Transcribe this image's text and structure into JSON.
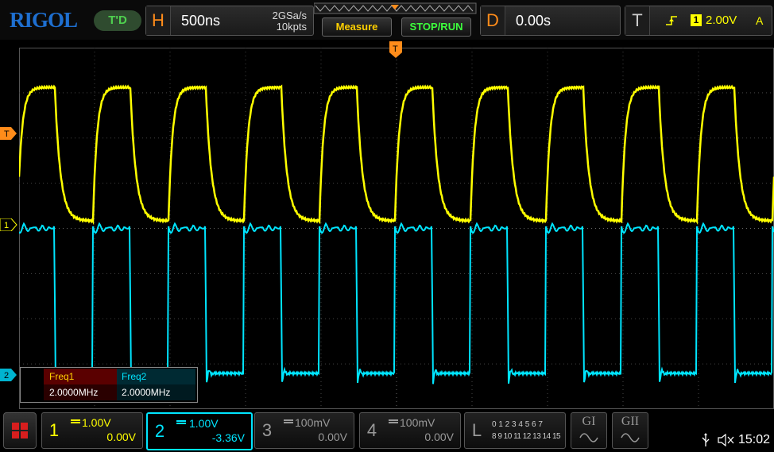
{
  "brand": "RIGOL",
  "run_mode": "T'D",
  "horizontal": {
    "letter": "H",
    "timebase": "500ns",
    "sample_rate": "2GSa/s",
    "memory": "10kpts"
  },
  "buttons": {
    "measure": "Measure",
    "stop_run": "STOP/RUN"
  },
  "delay": {
    "letter": "D",
    "value": "0.00s"
  },
  "trigger": {
    "letter": "T",
    "source": "1",
    "level": "2.00V",
    "mode": "A"
  },
  "markers": {
    "trigger_level": "T",
    "ch1": "1",
    "ch2": "2",
    "trigger_pos": "T"
  },
  "measurements": [
    {
      "label": "Freq1",
      "value": "2.0000MHz"
    },
    {
      "label": "Freq2",
      "value": "2.0000MHz"
    }
  ],
  "channels": [
    {
      "num": "1",
      "scale": "1.00V",
      "offset": "0.00V",
      "color": "#ffff00",
      "active": true
    },
    {
      "num": "2",
      "scale": "1.00V",
      "offset": "-3.36V",
      "color": "#00e5ff",
      "active": true
    },
    {
      "num": "3",
      "scale": "100mV",
      "offset": "0.00V",
      "color": "#888888",
      "active": false
    },
    {
      "num": "4",
      "scale": "100mV",
      "offset": "0.00V",
      "color": "#888888",
      "active": false
    }
  ],
  "logic": {
    "letter": "L",
    "row1": "0 1 2 3  4 5 6 7",
    "row2": "8 9 10 11 12 13 14 15"
  },
  "generators": [
    "GI",
    "GII"
  ],
  "status": {
    "time": "15:02"
  },
  "colors": {
    "ch1": "#ffff00",
    "ch2": "#00e5ff",
    "accent": "#ff8c1a",
    "run_green": "#3dff3d"
  }
}
